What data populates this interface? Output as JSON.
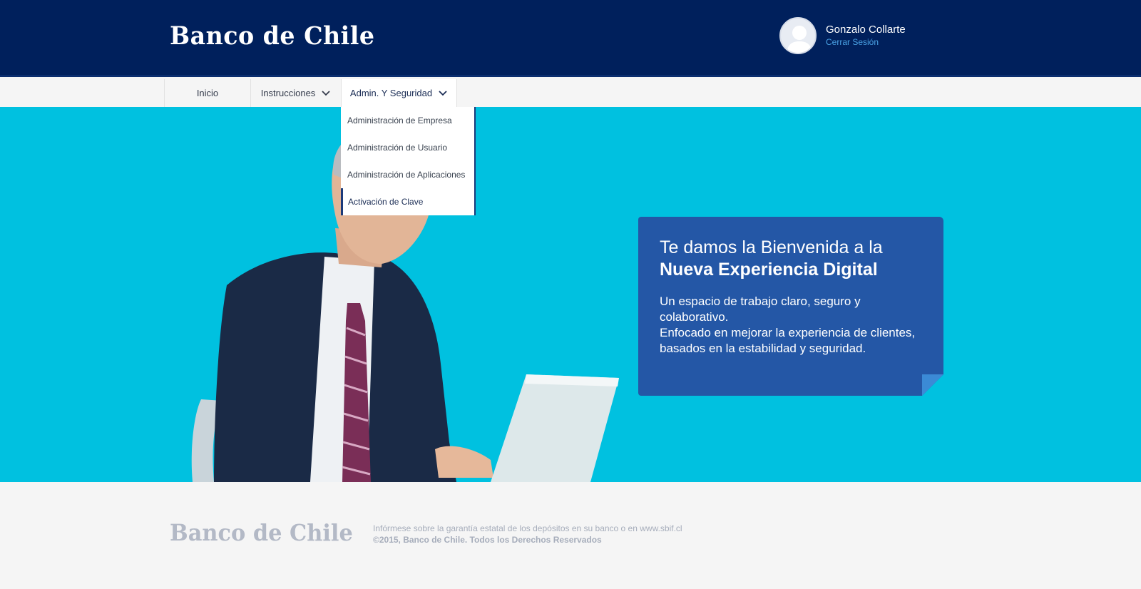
{
  "header": {
    "logo_text": "Banco de Chile",
    "user_name": "Gonzalo Collarte",
    "logout_label": "Cerrar Sesión"
  },
  "nav": {
    "items": [
      {
        "label": "Inicio",
        "has_dropdown": false
      },
      {
        "label": "Instrucciones",
        "has_dropdown": true
      },
      {
        "label": "Admin. Y Seguridad",
        "has_dropdown": true,
        "active": true
      }
    ]
  },
  "dropdown": {
    "items": [
      {
        "label": "Administración de Empresa"
      },
      {
        "label": "Administración de Usuario"
      },
      {
        "label": "Administración de Aplicaciones"
      },
      {
        "label": "Activación de Clave",
        "active": true
      }
    ]
  },
  "hero": {
    "title_line1": "Te damos la Bienvenida a la",
    "title_line2": "Nueva Experiencia Digital",
    "body_line1": "Un espacio de trabajo claro, seguro y colaborativo.",
    "body_line2": "Enfocado en mejorar la experiencia de clientes, basados en la estabilidad y seguridad.",
    "background_color": "#00c1e0",
    "card_color": "#2457a6"
  },
  "footer": {
    "logo_text": "Banco de Chile",
    "info_text": "Infórmese sobre la garantía estatal de los depósitos en su banco o en www.sbif.cl",
    "copyright": "©2015, Banco de Chile. Todos los Derechos Reservados"
  },
  "colors": {
    "brand_navy": "#00205c",
    "accent_blue": "#4aa3e6"
  }
}
